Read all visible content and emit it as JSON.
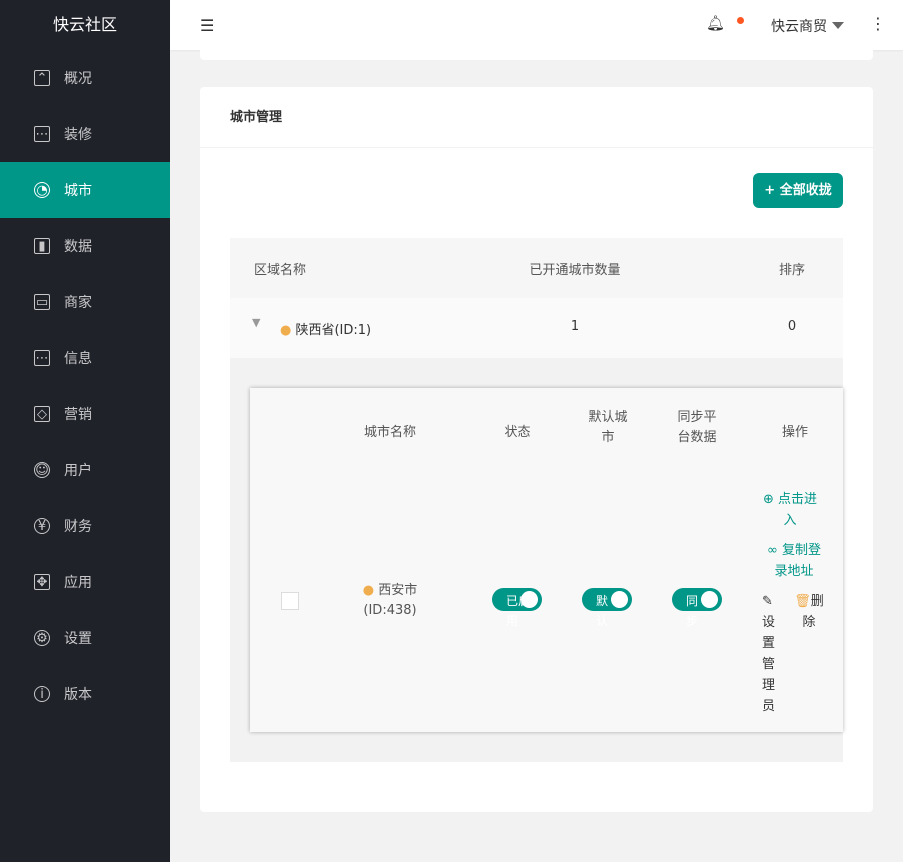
{
  "sidebar": {
    "logo": "快云社区",
    "items": [
      {
        "label": "概况",
        "icon": "dashboard-icon"
      },
      {
        "label": "装修",
        "icon": "message-icon"
      },
      {
        "label": "城市",
        "icon": "chart-pie-icon",
        "active": true
      },
      {
        "label": "数据",
        "icon": "bar-chart-icon"
      },
      {
        "label": "商家",
        "icon": "store-icon"
      },
      {
        "label": "信息",
        "icon": "message-icon"
      },
      {
        "label": "营销",
        "icon": "tag-icon"
      },
      {
        "label": "用户",
        "icon": "user-icon"
      },
      {
        "label": "财务",
        "icon": "yen-icon"
      },
      {
        "label": "应用",
        "icon": "apps-icon"
      },
      {
        "label": "设置",
        "icon": "gear-icon"
      },
      {
        "label": "版本",
        "icon": "info-icon"
      }
    ]
  },
  "header": {
    "user": "快云商贸",
    "has_notification": true
  },
  "card": {
    "title": "城市管理",
    "collapse_button": "+ 全部收拢",
    "columns": [
      "区域名称",
      "已开通城市数量",
      "排序"
    ],
    "province": {
      "name": "陕西省(ID:1)",
      "count": "1",
      "sort": "0"
    },
    "sub_columns": [
      "城市名称",
      "状态",
      "默认城市",
      "同步平台数据",
      "操作"
    ],
    "city": {
      "name": "西安市",
      "id": "(ID:438)",
      "status": "已启用",
      "default": "默认",
      "sync": "同步",
      "actions": {
        "enter": "点击进入",
        "copy": "复制登录地址",
        "admin": "设置管理员",
        "delete": "删除"
      }
    }
  },
  "colors": {
    "accent": "#009688",
    "sidebar": "#20222a",
    "dot": "#ff5722"
  }
}
